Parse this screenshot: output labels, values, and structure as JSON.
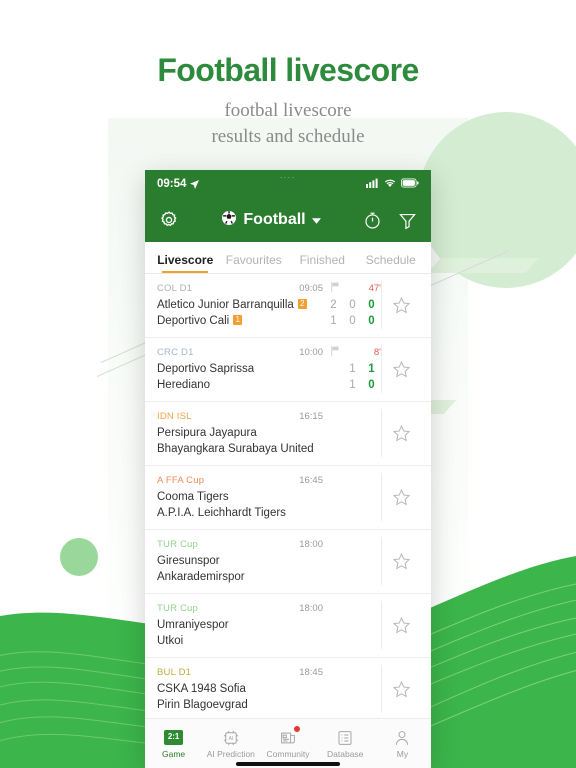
{
  "page": {
    "headline": "Football livescore",
    "subline_line1": "footbal livescore",
    "subline_line2": "results and schedule",
    "accent_green": "#2a7d2e",
    "accent_orange": "#f0a030",
    "live_red": "#e4594a"
  },
  "statusbar": {
    "time": "09:54",
    "location_icon": "location-arrow-icon",
    "signal_icon": "cellular-signal-icon",
    "wifi_icon": "wifi-icon",
    "battery_icon": "battery-icon"
  },
  "appbar": {
    "settings_icon": "gear-icon",
    "sport_icon": "football-icon",
    "sport_label": "Football",
    "dropdown_icon": "chevron-down-icon",
    "timer_icon": "stopwatch-icon",
    "filter_icon": "filter-icon"
  },
  "tabs": [
    {
      "label": "Livescore",
      "active": true
    },
    {
      "label": "Favourites",
      "active": false
    },
    {
      "label": "Finished",
      "active": false
    },
    {
      "label": "Schedule",
      "active": false
    }
  ],
  "matches": [
    {
      "league": "COL D1",
      "league_color": "#b0b0b0",
      "kickoff": "09:05",
      "has_flag": true,
      "minute": "47'",
      "home": {
        "name": "Atletico Junior Barranquilla",
        "badge": "2",
        "scores": [
          "2",
          "0",
          "0"
        ]
      },
      "away": {
        "name": "Deportivo Cali",
        "badge": "1",
        "scores": [
          "1",
          "0",
          "0"
        ]
      },
      "star_icon": "star-outline-icon"
    },
    {
      "league": "CRC D1",
      "league_color": "#aab4c8",
      "kickoff": "10:00",
      "has_flag": true,
      "minute": "8'",
      "home": {
        "name": "Deportivo Saprissa",
        "badge": "",
        "scores": [
          "1",
          "1"
        ]
      },
      "away": {
        "name": "Herediano",
        "badge": "",
        "scores": [
          "1",
          "0"
        ]
      },
      "star_icon": "star-outline-icon"
    },
    {
      "league": "IDN ISL",
      "league_color": "#f0a24a",
      "kickoff": "16:15",
      "has_flag": false,
      "minute": "",
      "home": {
        "name": "Persipura Jayapura",
        "badge": "",
        "scores": []
      },
      "away": {
        "name": "Bhayangkara Surabaya United",
        "badge": "",
        "scores": []
      },
      "star_icon": "star-outline-icon"
    },
    {
      "league": "A FFA Cup",
      "league_color": "#f08b5a",
      "kickoff": "16:45",
      "has_flag": false,
      "minute": "",
      "home": {
        "name": "Cooma Tigers",
        "badge": "",
        "scores": []
      },
      "away": {
        "name": "A.P.I.A. Leichhardt Tigers",
        "badge": "",
        "scores": []
      },
      "star_icon": "star-outline-icon"
    },
    {
      "league": "TUR Cup",
      "league_color": "#93d08c",
      "kickoff": "18:00",
      "has_flag": false,
      "minute": "",
      "home": {
        "name": "Giresunspor",
        "badge": "",
        "scores": []
      },
      "away": {
        "name": "Ankarademirspor",
        "badge": "",
        "scores": []
      },
      "star_icon": "star-outline-icon"
    },
    {
      "league": "TUR Cup",
      "league_color": "#93d08c",
      "kickoff": "18:00",
      "has_flag": false,
      "minute": "",
      "home": {
        "name": "Umraniyespor",
        "badge": "",
        "scores": []
      },
      "away": {
        "name": "Utkoi",
        "badge": "",
        "scores": []
      },
      "star_icon": "star-outline-icon"
    },
    {
      "league": "BUL D1",
      "league_color": "#bdae43",
      "kickoff": "18:45",
      "has_flag": false,
      "minute": "",
      "home": {
        "name": "CSKA 1948 Sofia",
        "badge": "",
        "scores": []
      },
      "away": {
        "name": "Pirin Blagoevgrad",
        "badge": "",
        "scores": []
      },
      "star_icon": "star-outline-icon"
    }
  ],
  "bottomnav": {
    "page_dots": "....",
    "items": [
      {
        "label": "Game",
        "icon": "scoreboard-icon",
        "icon_text": "2:1",
        "active": true,
        "badge": false
      },
      {
        "label": "AI Prediction",
        "icon": "ai-chip-icon",
        "icon_text": "AI",
        "active": false,
        "badge": false
      },
      {
        "label": "Community",
        "icon": "newspaper-icon",
        "icon_text": "",
        "active": false,
        "badge": true
      },
      {
        "label": "Database",
        "icon": "list-icon",
        "icon_text": "",
        "active": false,
        "badge": false
      },
      {
        "label": "My",
        "icon": "person-icon",
        "icon_text": "",
        "active": false,
        "badge": false
      }
    ]
  }
}
